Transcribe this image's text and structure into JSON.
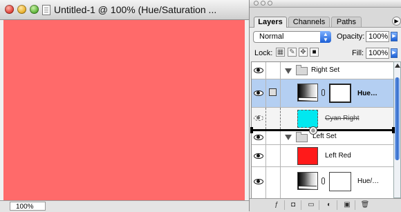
{
  "document": {
    "title": "Untitled-1 @ 100% (Hue/Saturation ...",
    "zoom": "100%",
    "canvas_color": "#ff6a6a"
  },
  "palette": {
    "tabs": [
      "Layers",
      "Channels",
      "Paths"
    ],
    "blend_mode": "Normal",
    "opacity_label": "Opacity:",
    "opacity_value": "100%",
    "lock_label": "Lock:",
    "fill_label": "Fill:",
    "fill_value": "100%",
    "layers": [
      {
        "name": "Right Set",
        "type": "group",
        "visible": true
      },
      {
        "name": "Hue…",
        "type": "adjustment",
        "visible": true,
        "selected": true
      },
      {
        "name": "Cyan Right",
        "type": "pixel",
        "color": "#00e8f0",
        "visible": false,
        "dragging": true
      },
      {
        "name": "Left Set",
        "type": "group",
        "visible": true
      },
      {
        "name": "Left Red",
        "type": "pixel",
        "color": "#ff1a1a",
        "visible": true
      },
      {
        "name": "Hue/…",
        "type": "adjustment",
        "visible": true
      }
    ]
  },
  "icons": {
    "close": "close-button-icon",
    "minimize": "minimize-button-icon",
    "zoom": "zoom-button-icon",
    "eye": "visibility-eye-icon",
    "folder": "layer-set-folder-icon",
    "chain": "mask-link-chain-icon"
  }
}
